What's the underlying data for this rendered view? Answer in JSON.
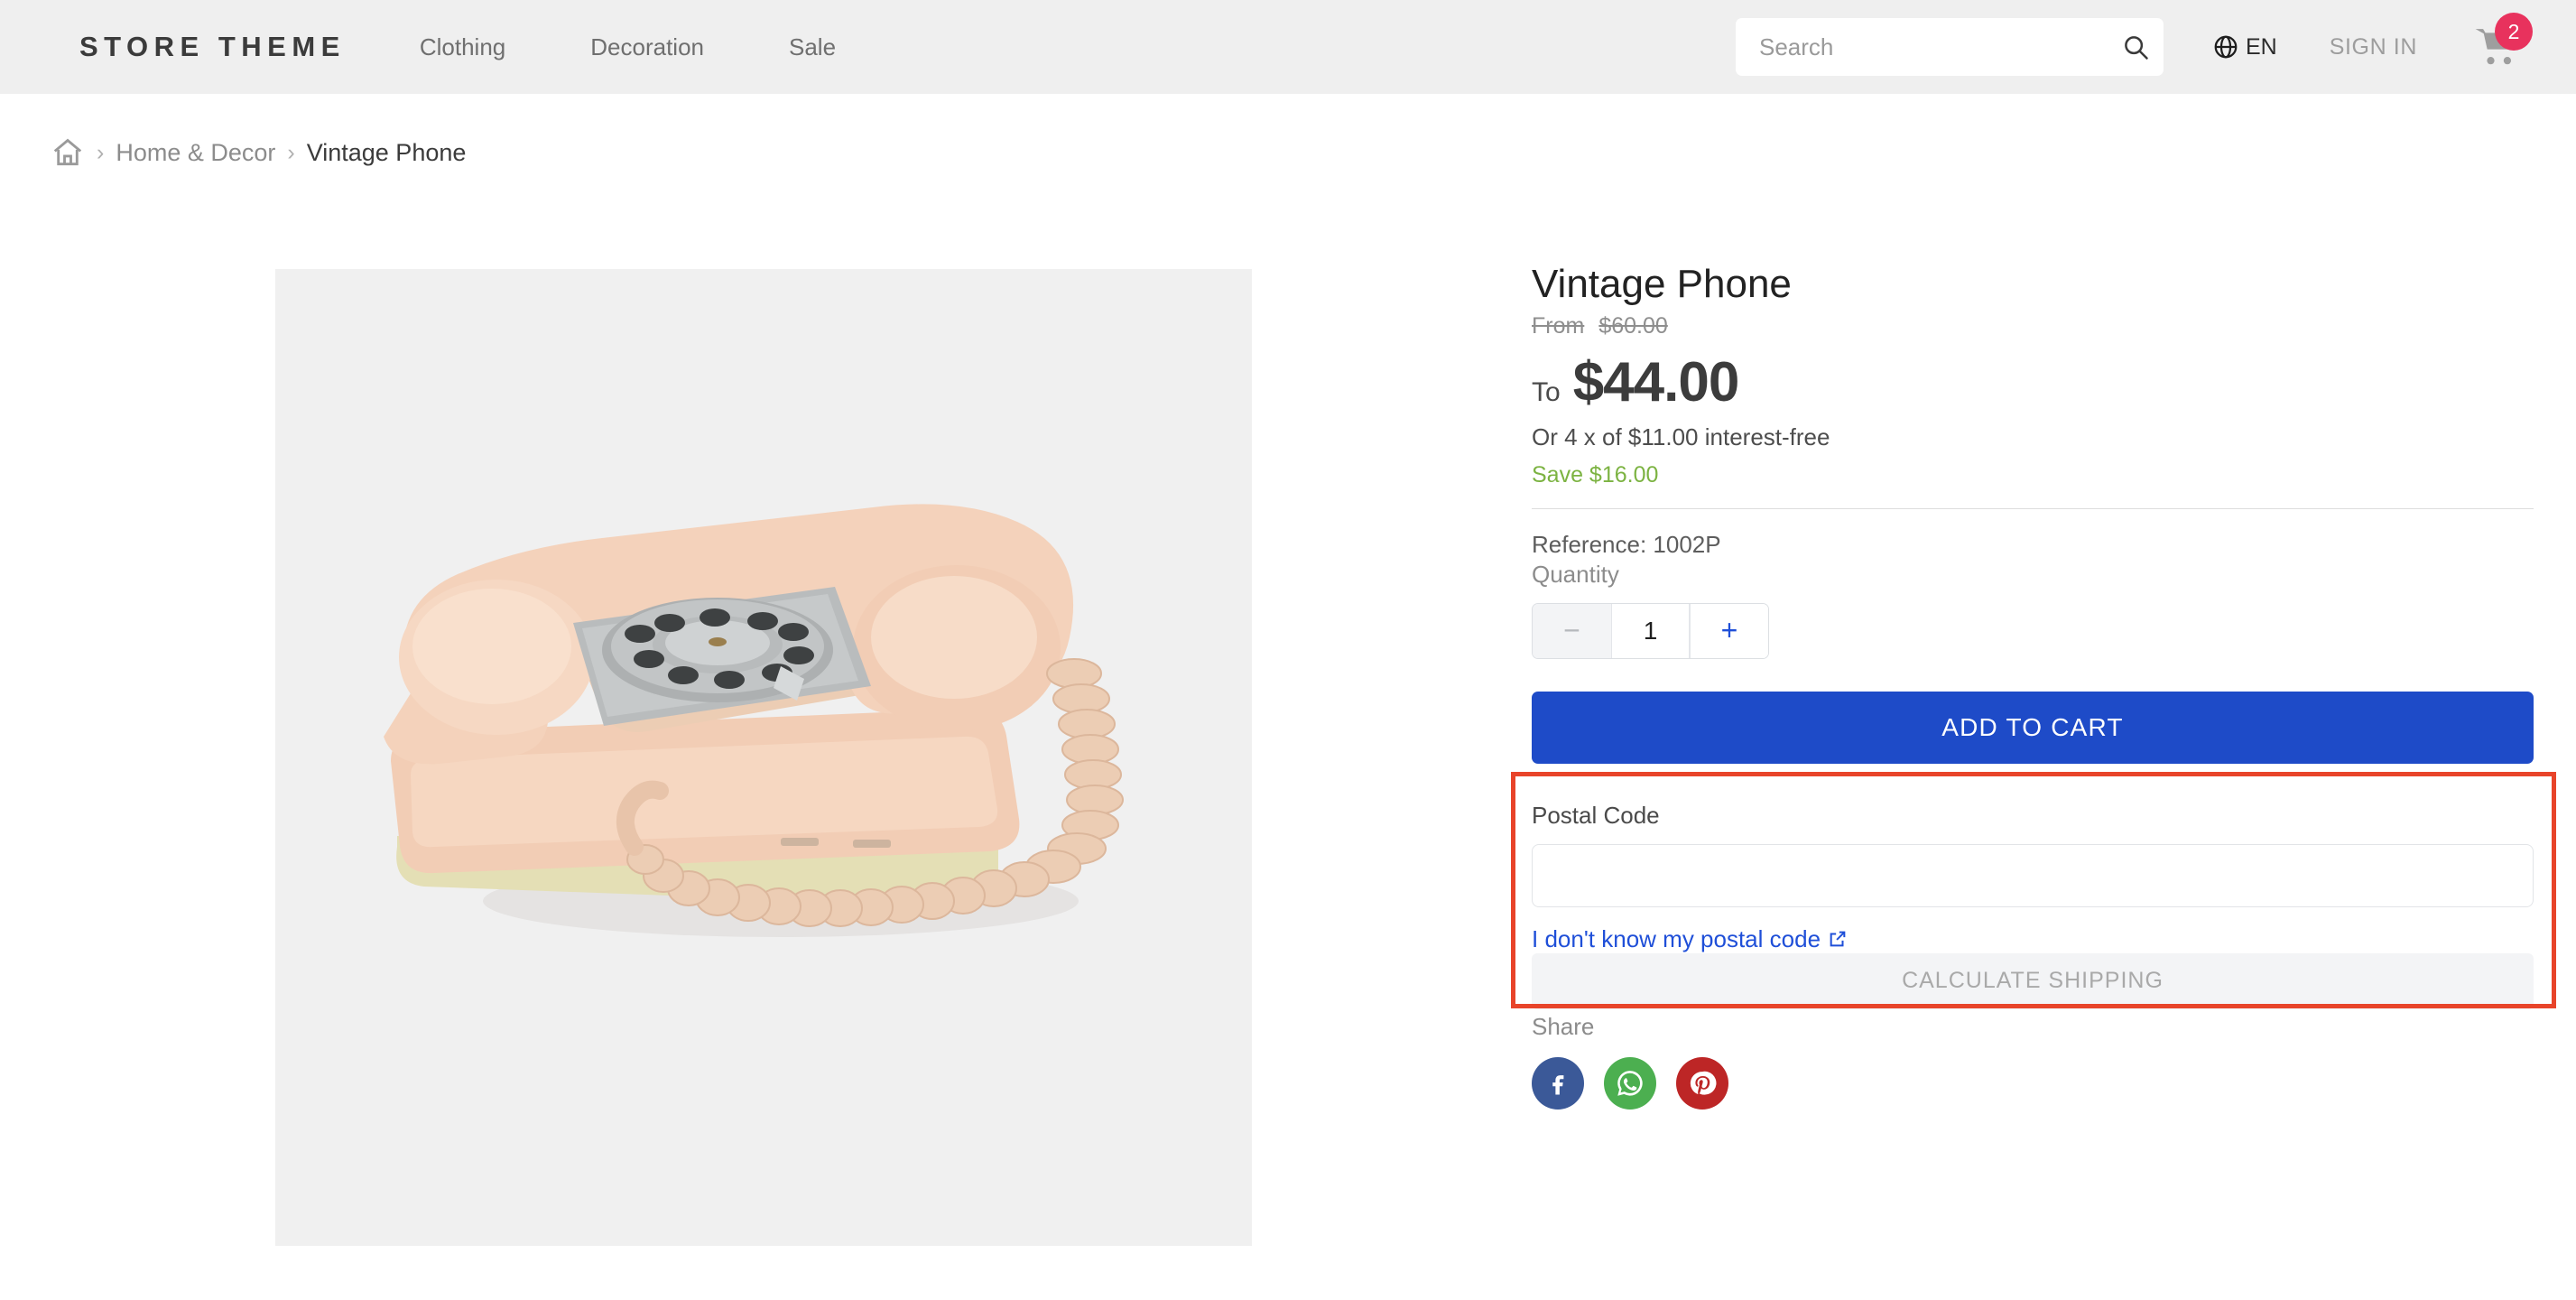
{
  "header": {
    "logo": "STORE THEME",
    "nav": [
      {
        "label": "Clothing"
      },
      {
        "label": "Decoration"
      },
      {
        "label": "Sale"
      }
    ],
    "search": {
      "placeholder": "Search",
      "value": ""
    },
    "language": "EN",
    "signin_label": "SIGN IN",
    "cart_count": "2",
    "badge_color": "#e8325d",
    "background": "#efefef"
  },
  "breadcrumb": {
    "home_icon": "home-icon",
    "separator": "›",
    "items": [
      {
        "label": "Home & Decor",
        "current": false
      },
      {
        "label": "Vintage Phone",
        "current": true
      }
    ]
  },
  "product": {
    "title": "Vintage Phone",
    "old_price_prefix": "From",
    "old_price": "$60.00",
    "price_prefix": "To",
    "price": "$44.00",
    "installments": "Or 4 x of $11.00 interest-free",
    "save": "Save $16.00",
    "save_color": "#7cb342",
    "reference": "Reference: 1002P",
    "quantity_label": "Quantity",
    "quantity_value": "1",
    "minus_symbol": "−",
    "plus_symbol": "+",
    "add_to_cart_label": "ADD TO CART",
    "add_to_cart_color": "#1e4bc8",
    "image_alt": "vintage-rotary-phone"
  },
  "shipping": {
    "postal_label": "Postal Code",
    "postal_value": "",
    "postal_placeholder": "",
    "help_link": "I don't know my postal code",
    "help_icon": "external-link-icon",
    "calculate_label": "CALCULATE SHIPPING",
    "highlight_color": "#e8442a"
  },
  "share": {
    "label": "Share",
    "buttons": [
      {
        "name": "facebook",
        "glyph": "f",
        "color": "#3b5998"
      },
      {
        "name": "whatsapp",
        "glyph": "",
        "color": "#4caf50"
      },
      {
        "name": "pinterest",
        "glyph": "",
        "color": "#bd2626"
      }
    ]
  }
}
